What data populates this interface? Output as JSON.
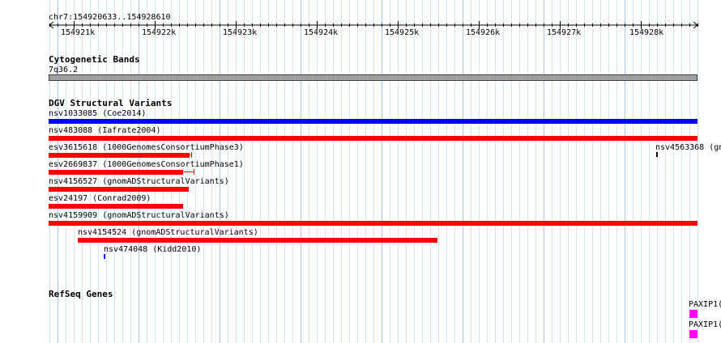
{
  "ruler": {
    "location": "chr7:154920633..154928610",
    "ticks": [
      "154921k",
      "154922k",
      "154923k",
      "154924k",
      "154925k",
      "154926k",
      "154927k",
      "154928k"
    ]
  },
  "cytoband": {
    "title": "Cytogenetic Bands",
    "label": "7q36.2"
  },
  "dgv": {
    "title": "DGV Structural Variants",
    "variants": [
      {
        "label": "nsv1033085 (Coe2014)",
        "color": "#0000ff"
      },
      {
        "label": "nsv483088 (Iafrate2004)",
        "color": "#ff0000"
      },
      {
        "label": "esv3615618 (1000GenomesConsortiumPhase3)",
        "color": "#ff0000"
      },
      {
        "label": "nsv4563368 (gn",
        "color": "#000000"
      },
      {
        "label": "esv2669837 (1000GenomesConsortiumPhase1)",
        "color": "#ff0000"
      },
      {
        "label": "nsv4156527 (gnomADStructuralVariants)",
        "color": "#ff0000"
      },
      {
        "label": "esv24197 (Conrad2009)",
        "color": "#ff0000"
      },
      {
        "label": "nsv4159909 (gnomADStructuralVariants)",
        "color": "#ff0000"
      },
      {
        "label": "nsv4154524 (gnomADStructuralVariants)",
        "color": "#ff0000"
      },
      {
        "label": "nsv474048 (Kidd2010)",
        "color": "#0000ff"
      }
    ]
  },
  "refseq": {
    "title": "RefSeq Genes",
    "genes": [
      {
        "label": "PAXIP1(",
        "color": "#ff00ff"
      },
      {
        "label": "PAXIP1(",
        "color": "#ff00ff"
      }
    ]
  }
}
